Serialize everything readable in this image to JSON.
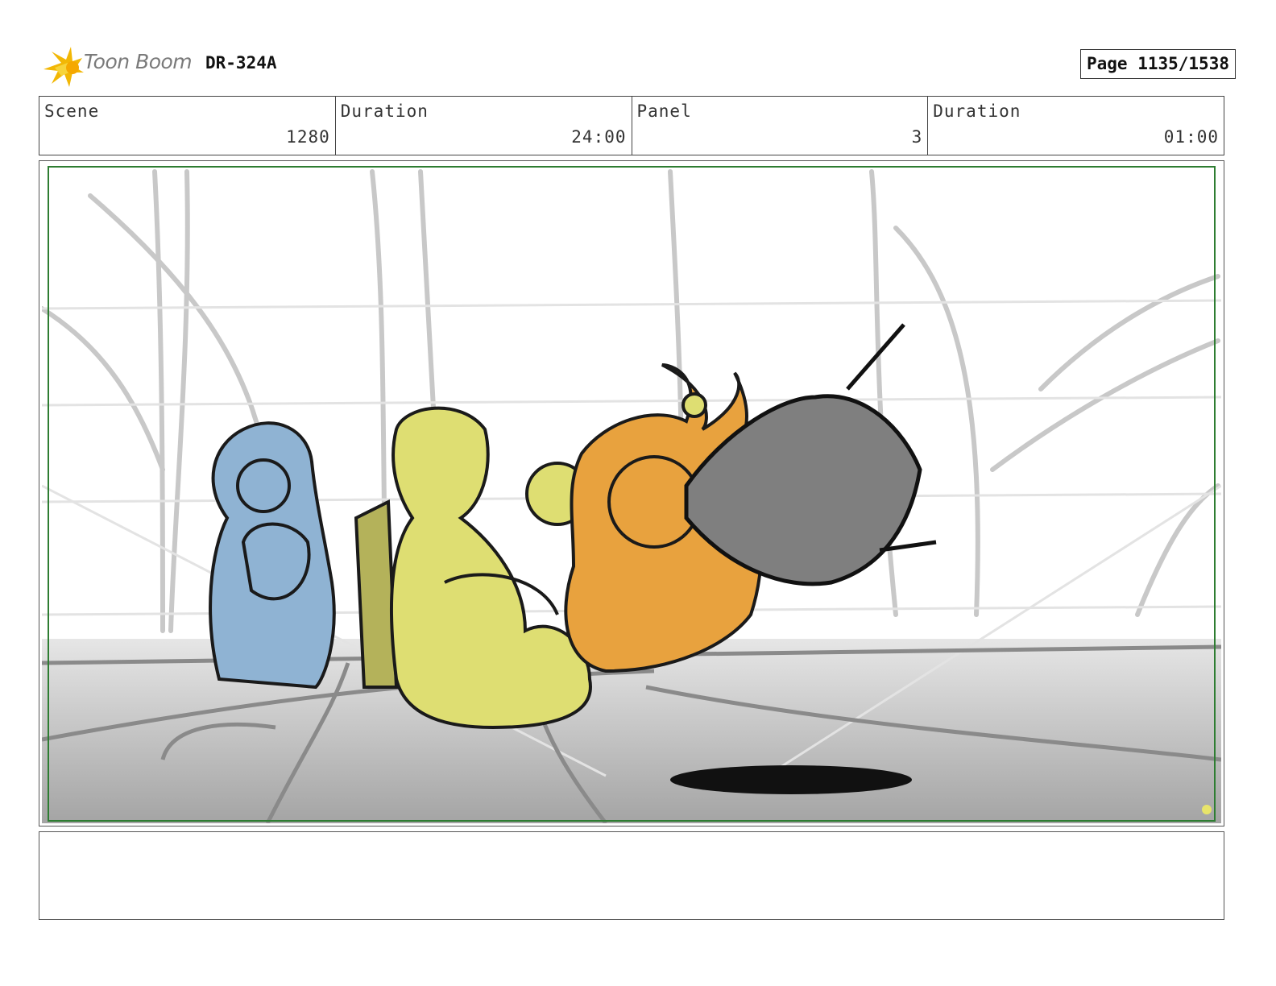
{
  "header": {
    "logo_text": "Toon Boom",
    "logo_icon": "toon-boom-burst-icon",
    "document_id": "DR-324A",
    "page_label": "Page 1135/1538"
  },
  "info": {
    "scene_label": "Scene",
    "scene_value": "1280",
    "scene_duration_label": "Duration",
    "scene_duration_value": "24:00",
    "panel_label": "Panel",
    "panel_value": "3",
    "panel_duration_label": "Duration",
    "panel_duration_value": "01:00"
  },
  "panel": {
    "frame_color": "#2e7d32",
    "character_colors": {
      "blue_character": "#8fb3d3",
      "yellow_character": "#dede72",
      "orange_character": "#e8a23e",
      "dark_shield": "#7f7f7f"
    }
  },
  "notes": {
    "text": ""
  }
}
